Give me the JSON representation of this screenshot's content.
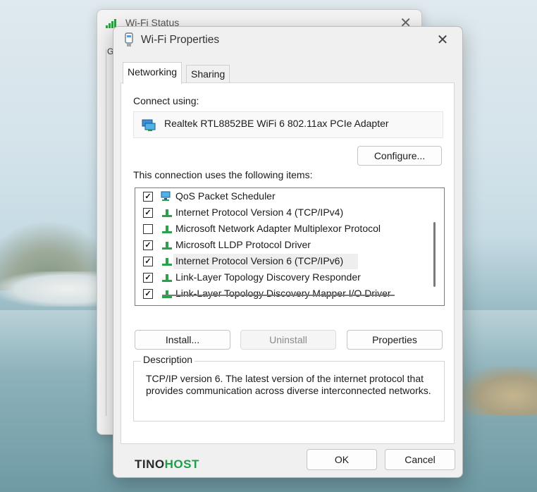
{
  "background_window": {
    "title": "Wi-Fi Status",
    "tab_initial": "G",
    "close_glyph": "✕"
  },
  "dialog": {
    "title": "Wi-Fi Properties",
    "close_glyph": "✕",
    "tabs": [
      {
        "label": "Networking",
        "active": true
      },
      {
        "label": "Sharing",
        "active": false
      }
    ],
    "connect_using_label": "Connect using:",
    "adapter": {
      "name": "Realtek RTL8852BE WiFi 6 802.11ax PCIe Adapter",
      "icon": "network-adapter-icon"
    },
    "configure_label": "Configure...",
    "items_label": "This connection uses the following items:",
    "items": [
      {
        "label": "QoS Packet Scheduler",
        "checked": true,
        "icon": "qos-scheduler-icon"
      },
      {
        "label": "Internet Protocol Version 4 (TCP/IPv4)",
        "checked": true,
        "icon": "protocol-icon"
      },
      {
        "label": "Microsoft Network Adapter Multiplexor Protocol",
        "checked": false,
        "icon": "protocol-icon"
      },
      {
        "label": "Microsoft LLDP Protocol Driver",
        "checked": true,
        "icon": "protocol-icon"
      },
      {
        "label": "Internet Protocol Version 6 (TCP/IPv6)",
        "checked": true,
        "icon": "protocol-icon",
        "selected": true
      },
      {
        "label": "Link-Layer Topology Discovery Responder",
        "checked": true,
        "icon": "protocol-icon"
      },
      {
        "label": "Link-Layer Topology Discovery Mapper I/O Driver",
        "checked": true,
        "icon": "protocol-icon"
      }
    ],
    "install_label": "Install...",
    "uninstall_label": "Uninstall",
    "properties_label": "Properties",
    "description": {
      "legend": "Description",
      "text": "TCP/IP version 6. The latest version of the internet protocol that provides communication across diverse interconnected networks."
    },
    "ok_label": "OK",
    "cancel_label": "Cancel"
  },
  "watermark": {
    "part1": "TINO",
    "part2": "HOST"
  },
  "colors": {
    "accent_green": "#1e9e4a",
    "protocol_icon_green": "#2aa14a"
  }
}
